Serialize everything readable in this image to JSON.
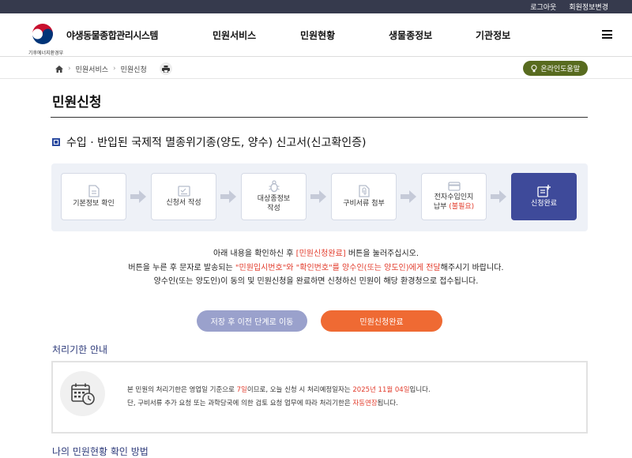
{
  "topbar": {
    "logout": "로그아웃",
    "edit_profile": "회원정보변경"
  },
  "header": {
    "logo_name": "야생동물종합관리시스템",
    "logo_sub": "기후에너지환경부",
    "nav": [
      "민원서비스",
      "민원현황",
      "생물종정보",
      "기관정보"
    ],
    "menu_icon": "hamburger-icon"
  },
  "breadcrumb": {
    "items": [
      "민원서비스",
      "민원신청"
    ],
    "home_icon": "home-icon",
    "print_icon": "print-icon"
  },
  "help_button": {
    "label": "온라인도움말",
    "icon": "lightbulb-icon",
    "color": "#586b1f"
  },
  "page": {
    "title": "민원신청",
    "subtitle": "수입 · 반입된 국제적 멸종위기종(양도, 양수) 신고서(신고확인증)"
  },
  "steps": [
    {
      "label": "기본정보 확인",
      "icon": "document-icon"
    },
    {
      "label": "신청서 작성",
      "icon": "form-check-icon"
    },
    {
      "label": "대상종정보\n작성",
      "icon": "bug-icon"
    },
    {
      "label": "구비서류 첨부",
      "icon": "attachment-icon"
    },
    {
      "label": "전자수입인지\n납부",
      "extra": "(불필요)",
      "icon": "card-icon"
    },
    {
      "label": "신청완료",
      "icon": "document-add-icon",
      "active": true
    }
  ],
  "notice": {
    "line1_a": "아래 내용을 확인하신 후 ",
    "line1_red": "[민원신청완료]",
    "line1_b": " 버튼을 눌러주십시오.",
    "line2_a": "버튼을 누른 후 문자로 발송되는 ",
    "line2_red": "\"민원입시번호\"와 \"확인번호\"를 양수인(또는 양도인)에게 전달",
    "line2_b": "해주시기 바랍니다.",
    "line3": "양수인(또는 양도인)이 동의 및 민원신청을 완료하면 신청하신 민원이 해당 환경청으로 접수됩니다."
  },
  "buttons": {
    "save_prev": "저장 후 이전 단계로 이동",
    "submit": "민원신청완료"
  },
  "processing": {
    "heading": "처리기한 안내",
    "icon": "calendar-clock-icon",
    "line1_a": "본 민원의 처리기한은 영업일 기준으로 ",
    "line1_days": "7일",
    "line1_b": "이므로, 오늘 신청 시 처리예정일자는 ",
    "line1_date": "2025년 11월 04일",
    "line1_c": "입니다.",
    "line2_a": "단, 구비서류 추가 요청 또는 과학당국에 의한 검토 요청 업무에 따라 처리기한은 ",
    "line2_red": "자동연장",
    "line2_b": "됩니다."
  },
  "next_section": {
    "heading": "나의 민원현황 확인 방법"
  },
  "colors": {
    "accent_red": "#e23b2b",
    "active_step": "#3e4a9a",
    "submit_button": "#ef6a33",
    "save_button": "#9aa1cc",
    "topbar": "#363a4d"
  }
}
